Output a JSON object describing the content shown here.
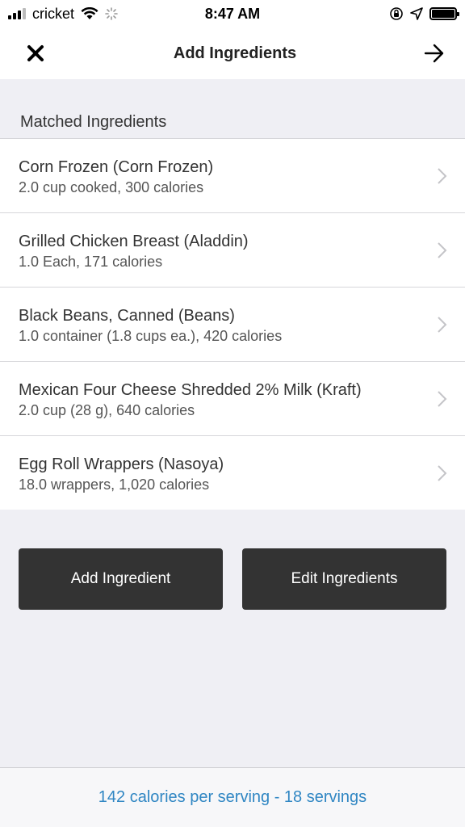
{
  "status_bar": {
    "carrier": "cricket",
    "time": "8:47 AM"
  },
  "nav": {
    "title": "Add Ingredients",
    "close_icon": "close-icon",
    "next_icon": "arrow-right-icon"
  },
  "section": {
    "header": "Matched Ingredients"
  },
  "ingredients": [
    {
      "name": "Corn Frozen (Corn Frozen)",
      "detail": "2.0 cup cooked, 300 calories"
    },
    {
      "name": "Grilled Chicken Breast (Aladdin)",
      "detail": "1.0 Each, 171 calories"
    },
    {
      "name": "Black Beans, Canned (Beans)",
      "detail": "1.0 container (1.8 cups ea.), 420 calories"
    },
    {
      "name": "Mexican Four Cheese Shredded 2% Milk (Kraft)",
      "detail": "2.0 cup (28 g), 640 calories"
    },
    {
      "name": "Egg Roll Wrappers (Nasoya)",
      "detail": "18.0 wrappers, 1,020 calories"
    }
  ],
  "buttons": {
    "add_label": "Add Ingredient",
    "edit_label": "Edit Ingredients"
  },
  "footer": {
    "summary": "142 calories per serving - 18 servings"
  },
  "colors": {
    "button_bg": "#333333",
    "footer_link": "#2f86c3",
    "page_bg": "#efeff4"
  }
}
